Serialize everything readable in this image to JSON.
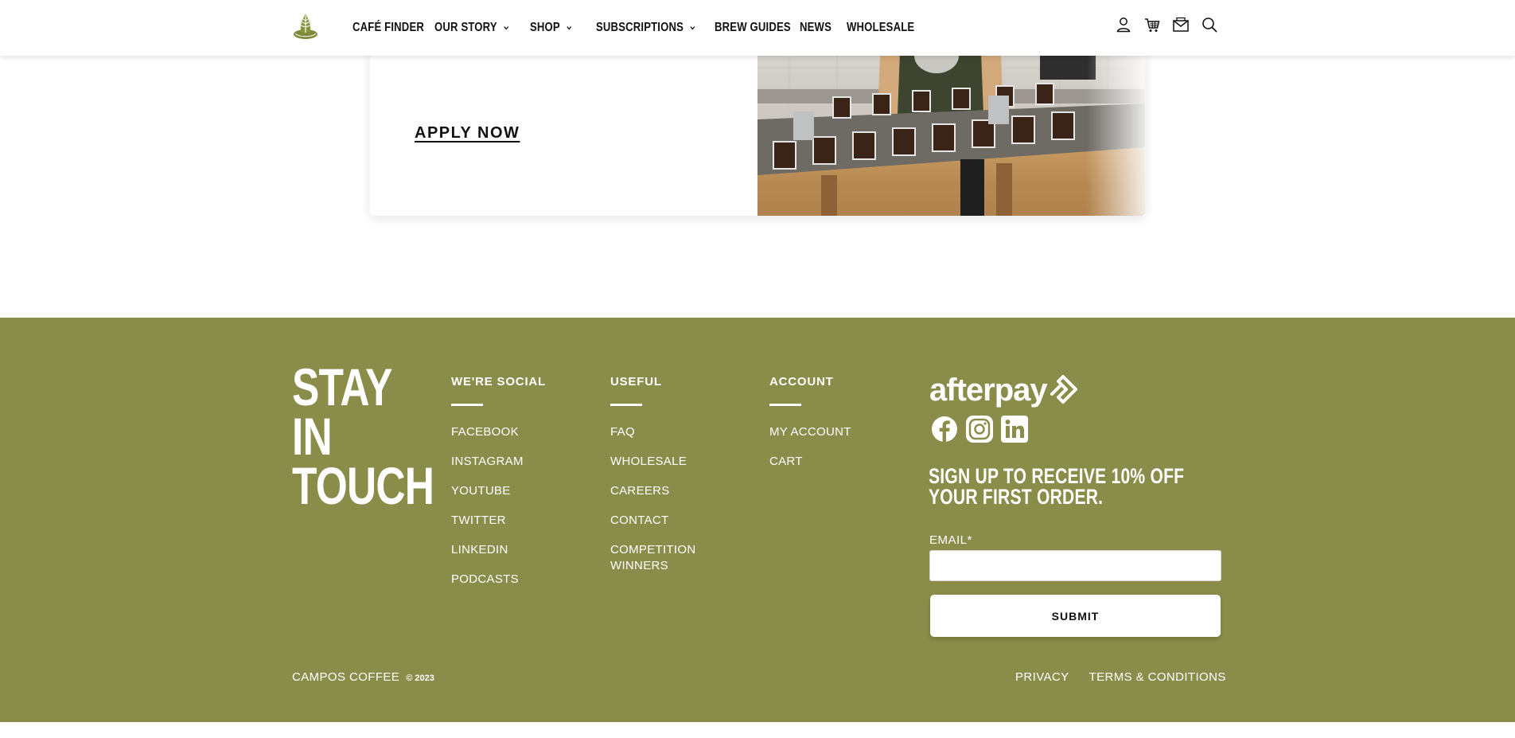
{
  "header": {
    "logo_icon": "campos-leaf-logo-icon",
    "nav": [
      {
        "label": "CAFÉ FINDER",
        "dropdown": false
      },
      {
        "label": "OUR STORY",
        "dropdown": true
      },
      {
        "label": "SHOP",
        "dropdown": true
      },
      {
        "label": "SUBSCRIPTIONS",
        "dropdown": true
      },
      {
        "label": "BREW GUIDES",
        "dropdown": false
      },
      {
        "label": "NEWS",
        "dropdown": false
      },
      {
        "label": "WHOLESALE",
        "dropdown": false
      }
    ],
    "icons": [
      "user-icon",
      "cart-icon",
      "mail-icon",
      "search-icon"
    ]
  },
  "promo": {
    "apply_label": "APPLY NOW"
  },
  "footer": {
    "background": "#8a8d4a",
    "title": "STAY IN TOUCH",
    "columns": {
      "social": {
        "heading": "WE'RE SOCIAL",
        "links": [
          "FACEBOOK",
          "INSTAGRAM",
          "YOUTUBE",
          "TWITTER",
          "LINKEDIN",
          "PODCASTS"
        ]
      },
      "useful": {
        "heading": "USEFUL",
        "links": [
          "FAQ",
          "WHOLESALE",
          "CAREERS",
          "CONTACT",
          "COMPETITION WINNERS"
        ]
      },
      "account": {
        "heading": "ACCOUNT",
        "links": [
          "MY ACCOUNT",
          "CART"
        ]
      }
    },
    "afterpay_text": "afterpay",
    "social_icons": [
      "facebook-icon",
      "instagram-icon",
      "linkedin-icon"
    ],
    "signup_title": "SIGN UP TO RECEIVE 10% OFF YOUR FIRST ORDER.",
    "email_label": "EMAIL*",
    "email_value": "",
    "submit_label": "SUBMIT",
    "brand": "CAMPOS COFFEE",
    "copyright": "© 2023",
    "legal_links": [
      "PRIVACY",
      "TERMS & CONDITIONS"
    ]
  }
}
